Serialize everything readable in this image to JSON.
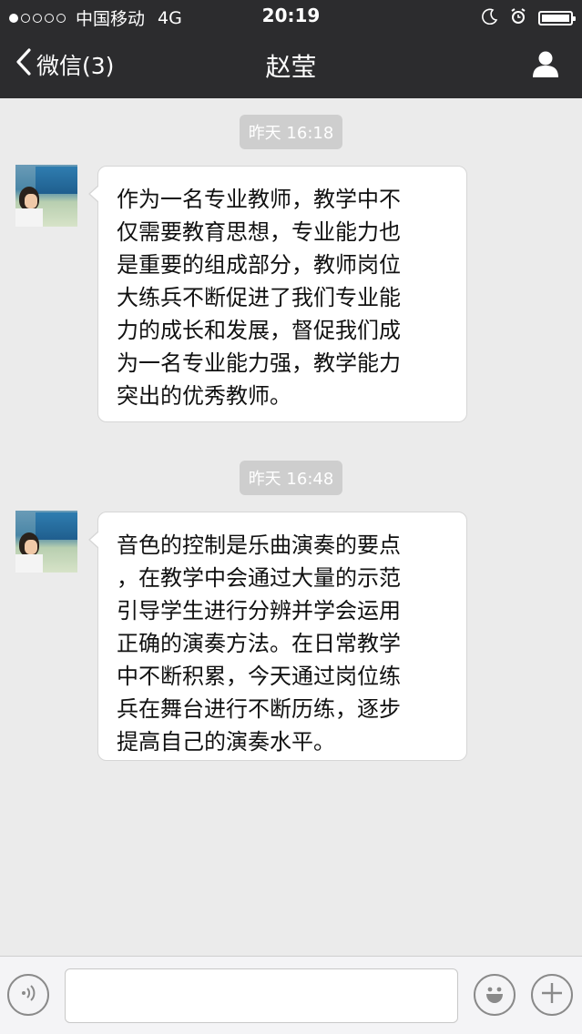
{
  "status_bar": {
    "signal_filled": 1,
    "signal_total": 5,
    "carrier": "中国移动",
    "network": "4G",
    "time": "20:19",
    "icons": [
      "moon-icon",
      "alarm-icon",
      "battery-icon"
    ]
  },
  "nav": {
    "back_label": "微信(3)",
    "title": "赵莹",
    "profile_icon": "person-icon"
  },
  "messages": [
    {
      "timestamp": "昨天 16:18",
      "lines": [
        "作为一名专业教师，教学中不",
        "仅需要教育思想，专业能力也",
        "是重要的组成部分，教师岗位",
        "大练兵不断促进了我们专业能",
        "力的成长和发展，督促我们成",
        "为一名专业能力强，教学能力",
        "突出的优秀教师。"
      ]
    },
    {
      "timestamp": "昨天 16:48",
      "lines": [
        "音色的控制是乐曲演奏的要点",
        "，在教学中会通过大量的示范",
        "引导学生进行分辨并学会运用",
        "正确的演奏方法。在日常教学",
        "中不断积累，今天通过岗位练",
        "兵在舞台进行不断历练，逐步",
        "提高自己的演奏水平。"
      ]
    }
  ],
  "input_bar": {
    "voice_icon": "voice-icon",
    "input_value": "",
    "emoji_icon": "emoji-icon",
    "plus_icon": "plus-icon"
  },
  "colors": {
    "nav_bg": "#2c2c2e",
    "chat_bg": "#ebebeb",
    "bubble_bg": "#ffffff",
    "timestamp_bg": "#cecece"
  }
}
